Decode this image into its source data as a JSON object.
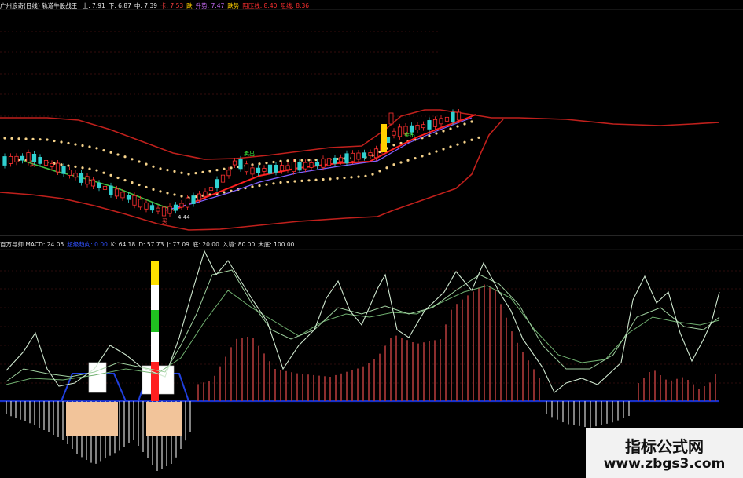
{
  "top_header": {
    "title": "广州浪奇(日线) 轨道牛股战王",
    "items": [
      {
        "label": "上: 7.91",
        "color": "#e8e8e8"
      },
      {
        "label": "下: 6.87",
        "color": "#e8e8e8"
      },
      {
        "label": "中: 7.39",
        "color": "#e8e8e8"
      },
      {
        "label": "卡: 7.53",
        "color": "#ff4040"
      },
      {
        "label": "跌",
        "color": "#ffd000"
      },
      {
        "label": "升势: 7.47",
        "color": "#d070ff"
      },
      {
        "label": "跌势",
        "color": "#ffd000"
      },
      {
        "label": "阻压线: 8.40",
        "color": "#ff3030"
      },
      {
        "label": "阻线: 8.36",
        "color": "#ff3030"
      }
    ]
  },
  "price_chart": {
    "annotations": [
      {
        "text": "买",
        "color": "#ff4040"
      },
      {
        "text": "买",
        "color": "#ff4040"
      },
      {
        "text": "4.44",
        "color": "#e0e0e0"
      },
      {
        "text": "卖出",
        "color": "#40ff40"
      },
      {
        "text": "卖出",
        "color": "#40ff40"
      }
    ],
    "colors": {
      "band": "#c0201c",
      "dots": "#f5d28a",
      "up": "#ff3030",
      "down": "#30d0d0",
      "avg_up": "#ff2020",
      "avg_green": "#40c040",
      "avg_purple": "#8060ff"
    }
  },
  "indicator_header": {
    "items": [
      {
        "label": "百万导师 MACD: 24.05",
        "color": "#e0e0e0"
      },
      {
        "label": "超级趋向: 0.00",
        "color": "#3050ff"
      },
      {
        "label": "K: 64.18",
        "color": "#e0e0e0"
      },
      {
        "label": "D: 57.73",
        "color": "#e0e0e0"
      },
      {
        "label": "J: 77.09",
        "color": "#e0e0e0"
      },
      {
        "label": "底: 20.00",
        "color": "#e0e0e0"
      },
      {
        "label": "入境: 80.00",
        "color": "#e0e0e0"
      },
      {
        "label": "大底: 100.00",
        "color": "#e0e0e0"
      }
    ],
    "colors": {
      "baseline": "#1830c8",
      "hist_up": "#b03a3a",
      "hist_down": "#d8d8d8",
      "line_a": "#d0e8d0",
      "line_b": "#70b070",
      "block": "#f2c49a"
    }
  },
  "watermark": {
    "line1": "指标公式网",
    "line2": "www.zbgs3.com"
  }
}
